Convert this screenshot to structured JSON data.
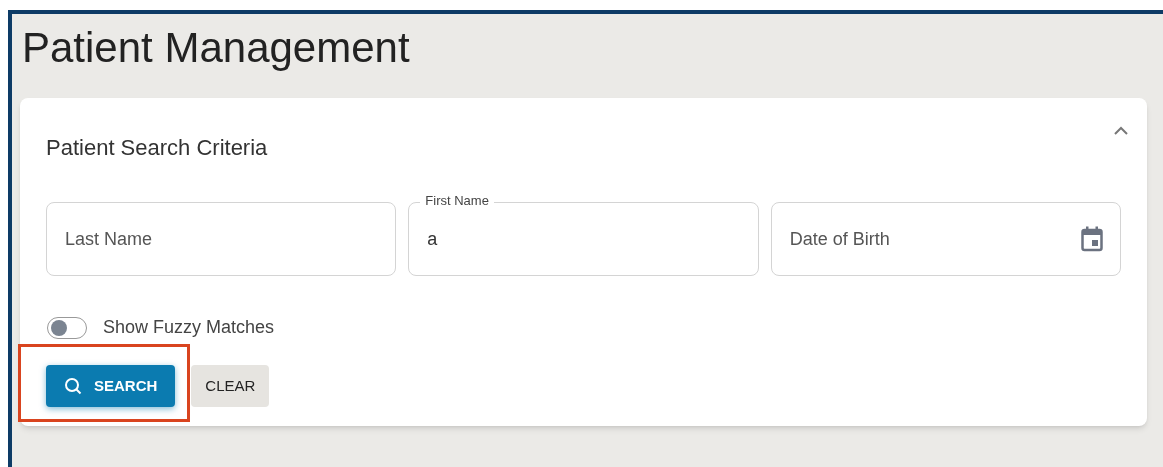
{
  "page": {
    "title": "Patient Management"
  },
  "search_panel": {
    "title": "Patient Search Criteria",
    "expanded": true,
    "fields": [
      {
        "kind": "text",
        "placeholder": "Last Name"
      },
      {
        "kind": "text",
        "label": "First Name",
        "value": "a"
      },
      {
        "kind": "date",
        "placeholder": "Date of Birth"
      }
    ],
    "toggle": {
      "label": "Show Fuzzy Matches",
      "on": false
    },
    "buttons": [
      {
        "kind": "primary",
        "label": "SEARCH",
        "highlighted": true
      },
      {
        "kind": "secondary",
        "label": "CLEAR",
        "highlighted": false
      }
    ]
  }
}
